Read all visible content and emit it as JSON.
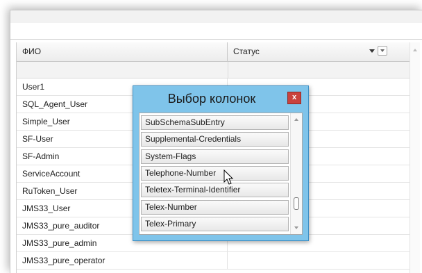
{
  "grid": {
    "columns": [
      "ФИО",
      "Статус"
    ],
    "rows": [
      {
        "fio": "User1",
        "status": ""
      },
      {
        "fio": "SQL_Agent_User",
        "status": ""
      },
      {
        "fio": "Simple_User",
        "status": ""
      },
      {
        "fio": "SF-User",
        "status": ""
      },
      {
        "fio": "SF-Admin",
        "status": ""
      },
      {
        "fio": "ServiceAccount",
        "status": ""
      },
      {
        "fio": "RuToken_User",
        "status": ""
      },
      {
        "fio": "JMS33_User",
        "status": ""
      },
      {
        "fio": "JMS33_pure_auditor",
        "status": ""
      },
      {
        "fio": "JMS33_pure_admin",
        "status": ""
      },
      {
        "fio": "JMS33_pure_operator",
        "status": ""
      }
    ]
  },
  "dialog": {
    "title": "Выбор колонок",
    "close_glyph": "x",
    "items": [
      "SubSchemaSubEntry",
      "Supplemental-Credentials",
      "System-Flags",
      "Telephone-Number",
      "Teletex-Terminal-Identifier",
      "Telex-Number",
      "Telex-Primary"
    ],
    "hovered_item": "Telephone-Number",
    "scroll_position_fraction": 0.85
  },
  "colors": {
    "dialog_background": "#7fc4ea",
    "close_button": "#c9423d"
  },
  "icons": [
    "sort-arrow-icon",
    "filter-dropdown-icon",
    "close-icon",
    "mouse-pointer-icon",
    "scroll-up-icon",
    "scroll-down-icon"
  ]
}
